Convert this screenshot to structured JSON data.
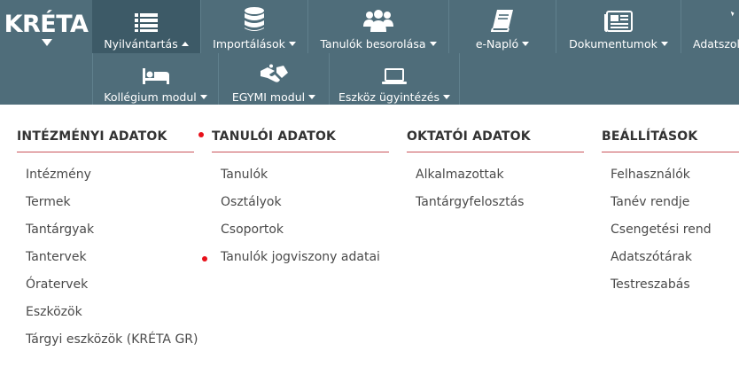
{
  "brand": {
    "logo_text": "KRÉTA"
  },
  "colors": {
    "navbar": "#4f6d7a",
    "navbar_active": "#3d5a67",
    "accent_red": "#e8101a",
    "section_rule": "#c9535a"
  },
  "top_nav": [
    {
      "label": "Nyilvántartás",
      "icon": "list-icon",
      "active": true
    },
    {
      "label": "Importálások",
      "icon": "database-icon"
    },
    {
      "label": "Tanulók besorolása",
      "icon": "users-group-icon"
    },
    {
      "label": "e-Napló",
      "icon": "book-icon"
    },
    {
      "label": "Dokumentumok",
      "icon": "newspaper-icon"
    },
    {
      "label": "Adatszol",
      "icon": "tools-icon"
    }
  ],
  "second_nav": [
    {
      "label": "Kollégium modul",
      "icon": "bed-icon"
    },
    {
      "label": "EGYMI modul",
      "icon": "handshake-icon"
    },
    {
      "label": "Eszköz ügyintézés",
      "icon": "laptop-icon"
    }
  ],
  "sections": [
    {
      "title": "INTÉZMÉNYI ADATOK",
      "items": [
        "Intézmény",
        "Termek",
        "Tantárgyak",
        "Tantervek",
        "Óratervek",
        "Eszközök",
        "Tárgyi eszközök (KRÉTA GR)"
      ]
    },
    {
      "title": "TANULÓI ADATOK",
      "items": [
        "Tanulók",
        "Osztályok",
        "Csoportok",
        "Tanulók jogviszony adatai"
      ]
    },
    {
      "title": "OKTATÓI ADATOK",
      "items": [
        "Alkalmazottak",
        "Tantárgyfelosztás"
      ]
    },
    {
      "title": "BEÁLLÍTÁSOK",
      "items": [
        "Felhasználók",
        "Tanév rendje",
        "Csengetési rend",
        "Adatszótárak",
        "Testreszabás"
      ]
    }
  ]
}
